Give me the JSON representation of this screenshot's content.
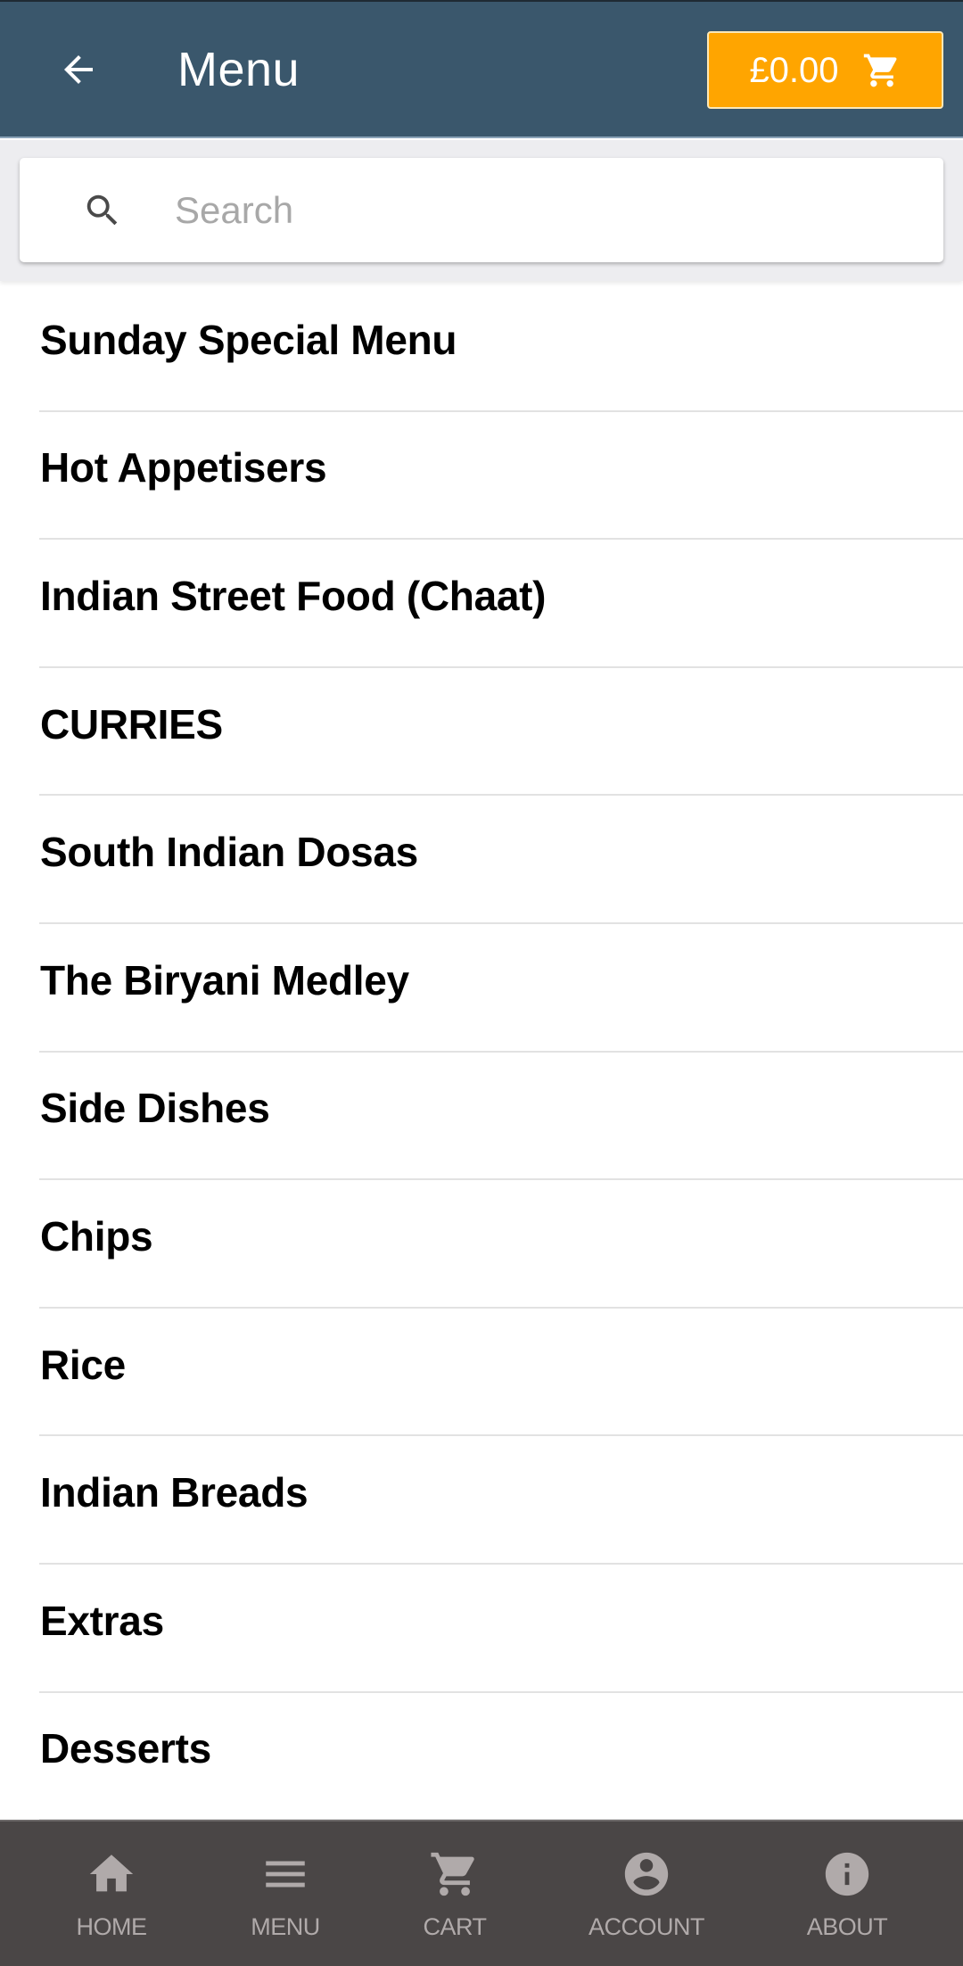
{
  "header": {
    "back_icon": "arrow-left-icon",
    "title": "Menu",
    "cart_total": "£0.00",
    "cart_icon": "shopping-cart-icon"
  },
  "search": {
    "icon": "search-icon",
    "placeholder": "Search",
    "value": ""
  },
  "menu": {
    "items": [
      {
        "label": "Sunday Special Menu"
      },
      {
        "label": "Hot Appetisers"
      },
      {
        "label": "Indian Street Food (Chaat)"
      },
      {
        "label": "CURRIES"
      },
      {
        "label": "South Indian Dosas"
      },
      {
        "label": "The Biryani Medley"
      },
      {
        "label": "Side Dishes"
      },
      {
        "label": "Chips"
      },
      {
        "label": "Rice"
      },
      {
        "label": "Indian Breads"
      },
      {
        "label": "Extras"
      },
      {
        "label": "Desserts"
      }
    ]
  },
  "bottom_nav": {
    "items": [
      {
        "label": "HOME",
        "icon": "home-icon"
      },
      {
        "label": "MENU",
        "icon": "menu-icon"
      },
      {
        "label": "CART",
        "icon": "shopping-cart-icon"
      },
      {
        "label": "ACCOUNT",
        "icon": "account-circle-icon"
      },
      {
        "label": "ABOUT",
        "icon": "info-icon"
      }
    ]
  },
  "colors": {
    "header_bg": "#3a576c",
    "cart_button_bg": "#ffa500",
    "search_area_bg": "#ededf0",
    "bottom_nav_bg": "#4a4646",
    "nav_icon": "#b0aaaa",
    "separator": "#e2e2e2"
  }
}
